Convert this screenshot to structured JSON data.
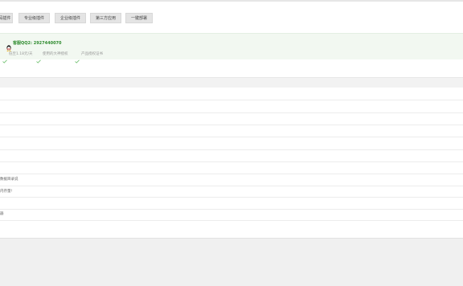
{
  "tabs": [
    {
      "label": "码插件"
    },
    {
      "label": "专业级插件"
    },
    {
      "label": "企业级插件"
    },
    {
      "label": "第三方应用"
    },
    {
      "label": "一键部署"
    }
  ],
  "promo": {
    "qq_text": "客服QQ2: 2927440070",
    "features": [
      {
        "text": "低至1.18元/天"
      },
      {
        "text": "使用的大神授权"
      },
      {
        "text": "产品授权证书"
      }
    ]
  },
  "table": {
    "row_labels": [
      {
        "text": "数据目录说"
      },
      {
        "text": "内存量!"
      },
      {
        "text": "器"
      }
    ]
  },
  "colors": {
    "accent_green": "#2d8a2d",
    "promo_bg": "#f2f8f1",
    "tab_bg": "#e4e4e4"
  }
}
